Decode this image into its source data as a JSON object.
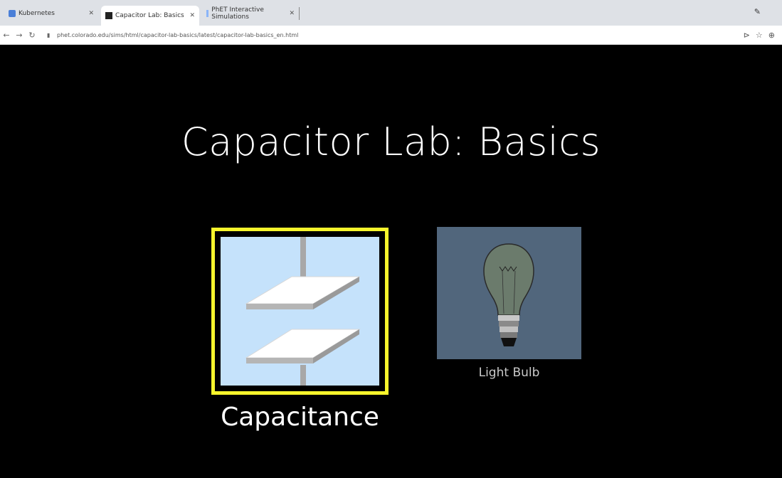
{
  "browser": {
    "tabs": [
      {
        "label": "Kubernetes",
        "active": false
      },
      {
        "label": "Capacitor Lab: Basics",
        "active": true
      },
      {
        "label": "PhET Interactive Simulations",
        "active": false
      }
    ],
    "url": "phet.colorado.edu/sims/html/capacitor-lab-basics/latest/capacitor-lab-basics_en.html"
  },
  "sim": {
    "title": "Capacitor Lab: Basics",
    "screens": [
      {
        "label": "Capacitance",
        "selected": true
      },
      {
        "label": "Light Bulb",
        "selected": false
      }
    ]
  },
  "colors": {
    "background": "#000000",
    "selection_border": "#f7f52c",
    "capacitance_bg": "#c5e2fb",
    "lightbulb_bg": "#51667c"
  }
}
